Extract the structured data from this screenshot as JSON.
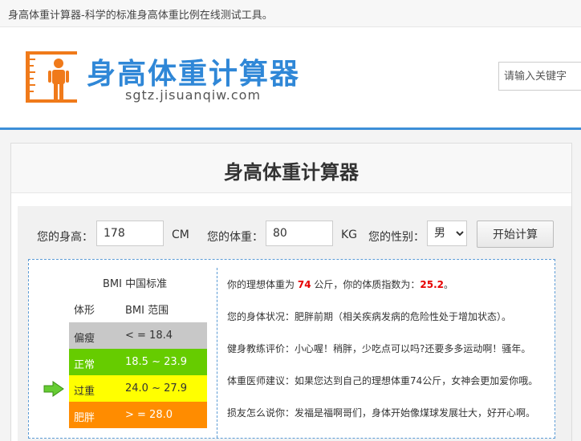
{
  "topbar": {
    "tagline": "身高体重计算器-科学的标准身高体重比例在线测试工具。"
  },
  "header": {
    "logo_title": "身高体重计算器",
    "logo_url": "sgtz.jisuanqiw.com",
    "search_placeholder": "请输入关键字"
  },
  "card": {
    "title": "身高体重计算器"
  },
  "form": {
    "height_label": "您的身高：",
    "height_value": "178",
    "height_unit": "CM",
    "weight_label": "您的体重：",
    "weight_value": "80",
    "weight_unit": "KG",
    "gender_label": "您的性别：",
    "gender_value": "男",
    "calc_button": "开始计算"
  },
  "bmi_table": {
    "title": "BMI 中国标准",
    "col_type": "体形",
    "col_range": "BMI 范围",
    "rows": [
      {
        "name": "偏瘦",
        "range": "< = 18.4",
        "color": "#c8c8c8",
        "text_color": "#333333"
      },
      {
        "name": "正常",
        "range": "18.5 ~ 23.9",
        "color": "#66cc00",
        "text_color": "#ffffff"
      },
      {
        "name": "过重",
        "range": "24.0 ~ 27.9",
        "color": "#ffff00",
        "text_color": "#333333"
      },
      {
        "name": "肥胖",
        "range": "> = 28.0",
        "color": "#ff8c00",
        "text_color": "#ffffff"
      }
    ],
    "highlighted_row": 2,
    "arrow_icon": "green-right-arrow",
    "arrow_color": "#66cc33"
  },
  "advice": {
    "ideal_prefix": "你的理想体重为",
    "ideal_weight": "74",
    "ideal_mid": "公斤，你的体质指数为：",
    "bmi_value": "25.2",
    "ideal_suffix": "。",
    "condition": "您的身体状况：肥胖前期（相关疾病发病的危险性处于增加状态）。",
    "coach": "健身教练评价：小心喔！稍胖，少吃点可以吗?还要多多运动啊！骚年。",
    "doctor": "体重医师建议：如果您达到自己的理想体重74公斤，女神会更加爱你哦。",
    "friend": "损友怎么说你：发福是福啊哥们，身体开始像煤球发展壮大，好开心啊。"
  },
  "colors": {
    "accent": "#2f87d7",
    "highlight_red": "#e60000",
    "logo_orange": "#f07a1a"
  }
}
